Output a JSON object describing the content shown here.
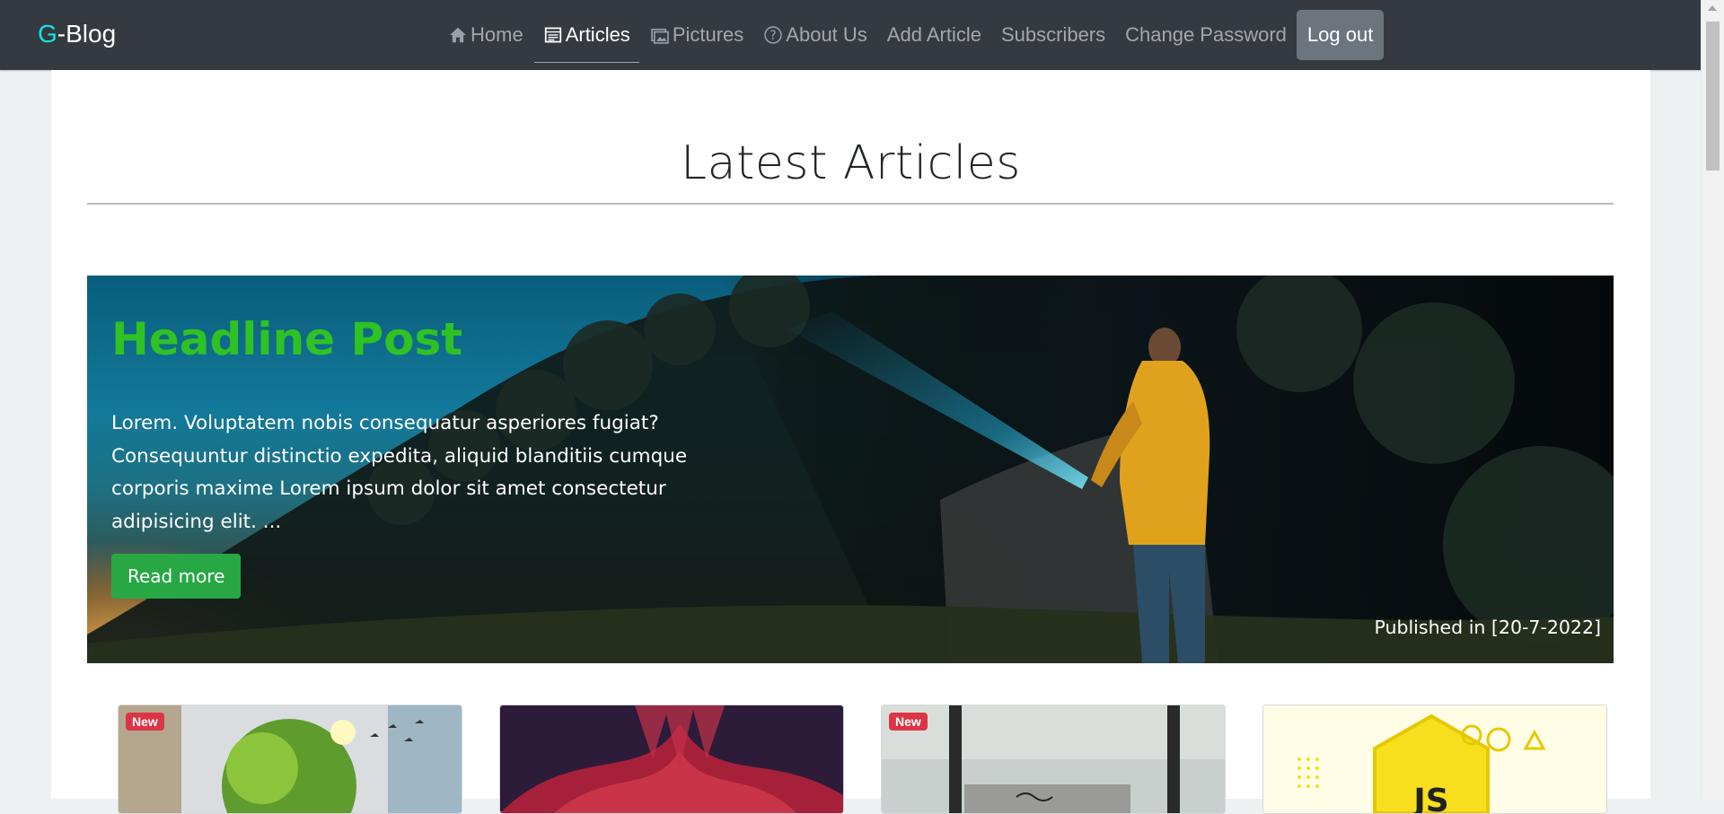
{
  "brand": {
    "accent": "G",
    "rest": "-Blog",
    "accent_color": "#17e3e8"
  },
  "nav": {
    "items": [
      {
        "label": "Home",
        "icon": "home-icon"
      },
      {
        "label": "Articles",
        "icon": "articles-icon",
        "active": true
      },
      {
        "label": "Pictures",
        "icon": "pictures-icon"
      },
      {
        "label": "About Us",
        "icon": "help-circle-icon"
      },
      {
        "label": "Add Article"
      },
      {
        "label": "Subscribers"
      },
      {
        "label": "Change Password"
      }
    ],
    "logout_label": "Log out"
  },
  "main": {
    "title": "Latest Articles",
    "hero": {
      "headline": "Headline Post",
      "excerpt": "Lorem. Voluptatem nobis consequatur asperiores fugiat? Consequuntur distinctio expedita, aliquid blanditiis cumque corporis maxime Lorem ipsum dolor sit amet consectetur adipisicing elit. ...",
      "read_more_label": "Read more",
      "published": "Published in [20-7-2022]",
      "headline_color": "#2ec224",
      "button_color": "#28a745"
    },
    "cards": [
      {
        "badge": "New"
      },
      {
        "badge": ""
      },
      {
        "badge": "New"
      },
      {
        "badge": ""
      }
    ]
  }
}
